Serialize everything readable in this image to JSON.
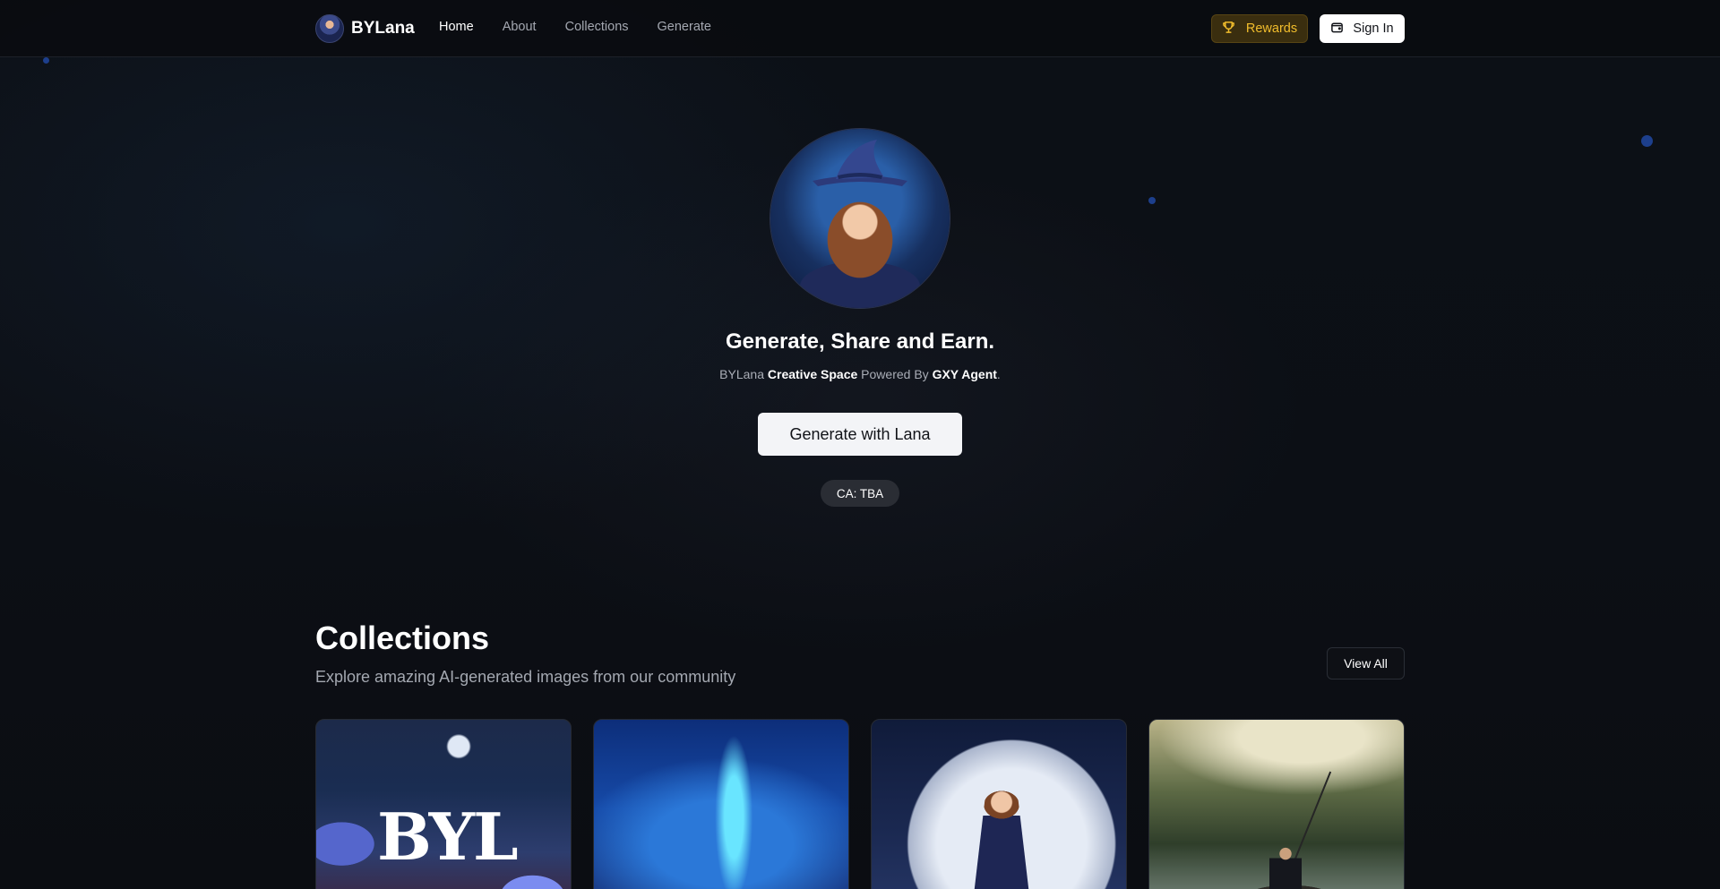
{
  "nav": {
    "brand": "BYLana",
    "links": [
      {
        "label": "Home",
        "active": true
      },
      {
        "label": "About",
        "active": false
      },
      {
        "label": "Collections",
        "active": false
      },
      {
        "label": "Generate",
        "active": false
      }
    ],
    "rewards_label": "Rewards",
    "rewards_icon": "trophy-icon",
    "signin_label": "Sign In",
    "signin_icon": "wallet-icon"
  },
  "hero": {
    "title": "Generate, Share and Earn.",
    "subtitle": {
      "prefix": "BYLana ",
      "brand_space": "Creative Space",
      "powered": " Powered By ",
      "agent": "GXY Agent",
      "suffix": "."
    },
    "cta_label": "Generate with Lana",
    "ca_badge": "CA: TBA"
  },
  "collections": {
    "title": "Collections",
    "subtitle": "Explore amazing AI-generated images from our community",
    "view_all_label": "View All",
    "cards": [
      {
        "image": "forest-mushroom-village-logo-art",
        "overlay_text": "BYL"
      },
      {
        "image": "blue-magic-stream-castle-art"
      },
      {
        "image": "witch-on-broom-full-moon-art"
      },
      {
        "image": "man-fishing-in-boat-forest-lake-art"
      }
    ]
  },
  "colors": {
    "background": "#0b0d12",
    "rewards_accent": "#f1bd2c",
    "rewards_bg": "#3a2e0f",
    "button_light": "#f3f4f7",
    "badge_bg": "#2a2d34"
  }
}
